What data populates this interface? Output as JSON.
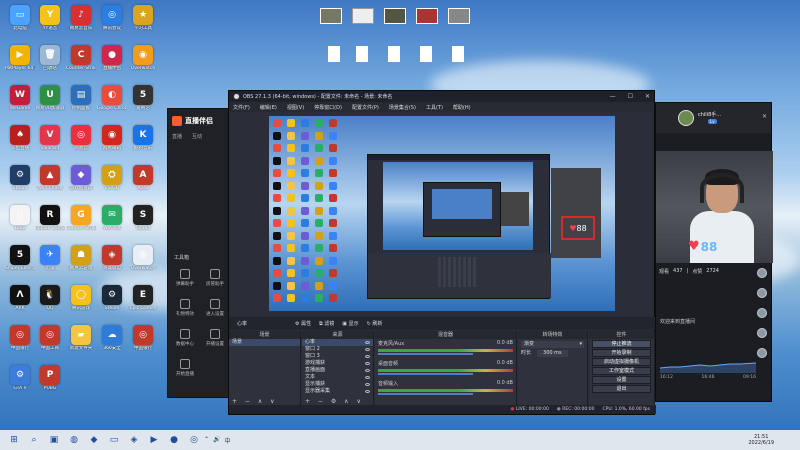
{
  "desktop": {
    "icons": [
      {
        "label": "此电脑",
        "color": "#4aa3ff",
        "glyph": "▭"
      },
      {
        "label": "YY语音",
        "color": "#f5c21b",
        "glyph": "Y"
      },
      {
        "label": "网易云音乐",
        "color": "#d83030",
        "glyph": "♪"
      },
      {
        "label": "腾讯会议",
        "color": "#2a7de1",
        "glyph": "◎"
      },
      {
        "label": "学习工具",
        "color": "#d9a420",
        "glyph": "★"
      },
      {
        "label": "PotPlayer 64 bit",
        "color": "#f2b400",
        "glyph": "▶"
      },
      {
        "label": "回收站",
        "color": "#9bb7d6",
        "glyph": "🗑"
      },
      {
        "label": "Counter-Strike",
        "color": "#c0392b",
        "glyph": "C"
      },
      {
        "label": "直播伴侣",
        "color": "#d0264a",
        "glyph": "●"
      },
      {
        "label": "Overwatch",
        "color": "#f29b1d",
        "glyph": "◉"
      },
      {
        "label": "WeGame",
        "color": "#c21e3a",
        "glyph": "W"
      },
      {
        "label": "网易UU加速器",
        "color": "#2f8f45",
        "glyph": "U"
      },
      {
        "label": "控制面板",
        "color": "#2c6fb8",
        "glyph": "▤"
      },
      {
        "label": "Google Chrome",
        "color": "#e94b3c",
        "glyph": "◐"
      },
      {
        "label": "爱奇艺",
        "color": "#333",
        "glyph": "5"
      },
      {
        "label": "斗鱼直播",
        "color": "#b81f1f",
        "glyph": "♠"
      },
      {
        "label": "Valorant",
        "color": "#e3364a",
        "glyph": "V"
      },
      {
        "label": "网易云",
        "color": "#e7323d",
        "glyph": "◎"
      },
      {
        "label": "网易邮箱",
        "color": "#d3261d",
        "glyph": "◉"
      },
      {
        "label": "酷狗音乐",
        "color": "#1a73e8",
        "glyph": "K"
      },
      {
        "label": "Steam",
        "color": "#1f3d67",
        "glyph": "⚙"
      },
      {
        "label": "Wild Chase",
        "color": "#c0392b",
        "glyph": "▲"
      },
      {
        "label": "游戏加速器",
        "color": "#6e5bd6",
        "glyph": "◆"
      },
      {
        "label": "CS:GO",
        "color": "#d4a017",
        "glyph": "⛭"
      },
      {
        "label": "Apex",
        "color": "#c0392b",
        "glyph": "A"
      },
      {
        "label": "Leap",
        "color": "#f4f4f4",
        "glyph": "▯"
      },
      {
        "label": "Roblox Studio",
        "color": "#111",
        "glyph": "R"
      },
      {
        "label": "Counter-Strike",
        "color": "#f5a623",
        "glyph": "G"
      },
      {
        "label": "WeChat",
        "color": "#2aae67",
        "glyph": "✉"
      },
      {
        "label": "Squad",
        "color": "#222",
        "glyph": "S"
      },
      {
        "label": "Sniper Elite 5",
        "color": "#111",
        "glyph": "5"
      },
      {
        "label": "迅雷",
        "color": "#3b82f6",
        "glyph": "✈"
      },
      {
        "label": "网易云游戏",
        "color": "#d4a017",
        "glyph": "☗"
      },
      {
        "label": "英雄联盟",
        "color": "#c0392b",
        "glyph": "◈"
      },
      {
        "label": "Overwatch",
        "color": "#e8eef5",
        "glyph": "◍"
      },
      {
        "label": "ARK",
        "color": "#111",
        "glyph": "Λ"
      },
      {
        "label": "QQ",
        "color": "#1a1a1a",
        "glyph": "🐧"
      },
      {
        "label": "腾讯游戏",
        "color": "#f5c21b",
        "glyph": "◯"
      },
      {
        "label": "Steam",
        "color": "#1b2838",
        "glyph": "⚙"
      },
      {
        "label": "Epic Games",
        "color": "#222",
        "glyph": "E"
      },
      {
        "label": "中国银行",
        "color": "#c0392b",
        "glyph": "◎"
      },
      {
        "label": "中国工商",
        "color": "#c0392b",
        "glyph": "◎"
      },
      {
        "label": "新建文件夹",
        "color": "#f4c542",
        "glyph": "▰"
      },
      {
        "label": "360安全",
        "color": "#2f7bd8",
        "glyph": "☁"
      },
      {
        "label": "中国银行",
        "color": "#c0392b",
        "glyph": "◎"
      },
      {
        "label": "GTA V",
        "color": "#3b7dd8",
        "glyph": "⚙"
      },
      {
        "label": "PUBG",
        "color": "#c0392b",
        "glyph": "P"
      }
    ]
  },
  "live_app": {
    "title": "直播伴侣",
    "tabs": [
      "直播",
      "互动"
    ],
    "tools_title": "工具箱",
    "tools": [
      {
        "label": "弹幕助手"
      },
      {
        "label": "房管助手"
      },
      {
        "label": "礼物特效"
      },
      {
        "label": "进入设置"
      },
      {
        "label": "数据中心"
      },
      {
        "label": "开播设置"
      },
      {
        "label": "开始直播"
      }
    ]
  },
  "obs": {
    "title": "OBS 27.1.3 (64-bit, windows) - 配置文件: 未命名 - 场景: 未命名",
    "menu": [
      "文件(F)",
      "编辑(E)",
      "视图(V)",
      "停靠窗口(D)",
      "配置文件(P)",
      "场景集合(S)",
      "工具(T)",
      "帮助(H)"
    ],
    "window_controls": [
      "—",
      "☐",
      "✕"
    ],
    "control_bar": {
      "scene_name": "心率",
      "buttons": [
        "属性",
        "滤镜",
        "显示",
        "刷新"
      ]
    },
    "docks": {
      "scenes": {
        "title": "场景",
        "items": [
          "场景"
        ]
      },
      "sources": {
        "title": "来源",
        "items": [
          "心率",
          "窗口 2",
          "窗口 3",
          "游戏捕获",
          "直播画面",
          "文本",
          "显示捕获",
          "显示器采集"
        ]
      },
      "mixer": {
        "title": "混音器",
        "tracks": [
          {
            "name": "麦克风/Aux",
            "level": "0.0 dB"
          },
          {
            "name": "桌面音频",
            "level": "0.0 dB"
          },
          {
            "name": "音频输入",
            "level": "0.0 dB"
          }
        ]
      },
      "transitions": {
        "title": "转场特效",
        "type": "渐变",
        "duration_label": "时长",
        "duration": "300 ms"
      },
      "controls": {
        "title": "控件",
        "buttons": [
          "停止推流",
          "开始录制",
          "启动虚拟摄像机",
          "工作室模式",
          "设置",
          "退出"
        ]
      }
    },
    "status": {
      "live": "LIVE: 00:00:00",
      "rec": "REC: 00:00:00",
      "cpu": "CPU: 1.0%, 60.00 fps"
    }
  },
  "stream_panel": {
    "username": "chili8手...",
    "level_badge": "Lv",
    "heart_count": "88",
    "stats": {
      "likes": "437",
      "viewers": "2724"
    },
    "stat_labels": [
      "观看",
      "点赞"
    ],
    "chart_ticks": [
      "16:12",
      "16:46",
      "09:16"
    ],
    "welcome": "欢迎来到直播间"
  },
  "taskbar": {
    "items": [
      "⊞",
      "⌕",
      "▣",
      "◍",
      "◆",
      "▭",
      "◈",
      "▶",
      "●",
      "◎"
    ],
    "time": "21:51",
    "date": "2022/6/19",
    "tray": [
      "⌃",
      "🔊",
      "中"
    ]
  }
}
